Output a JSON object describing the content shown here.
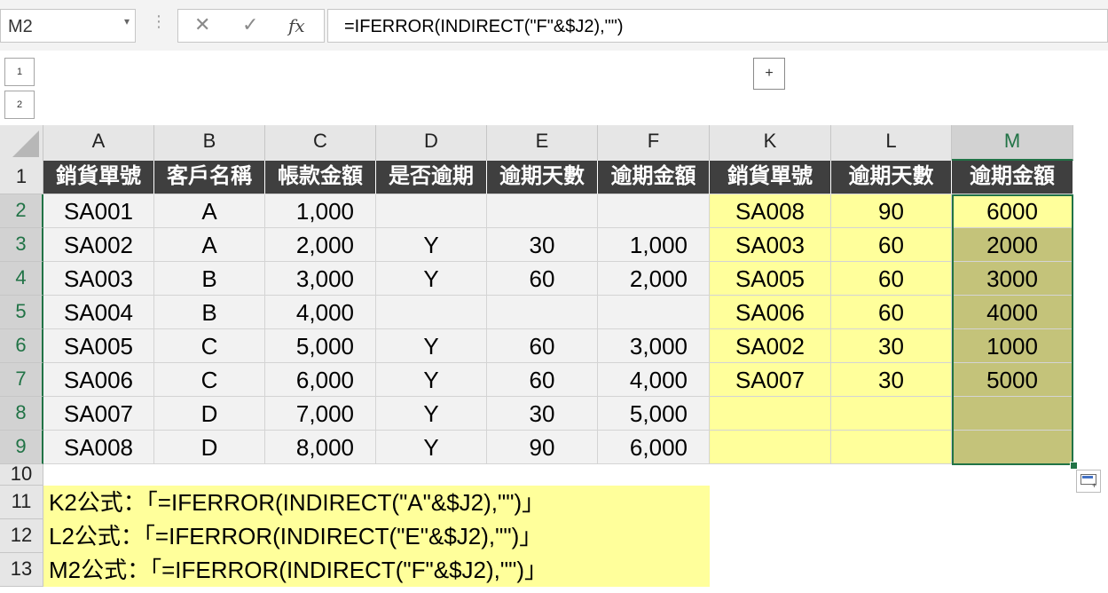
{
  "name_box": "M2",
  "formula_bar": {
    "cancel_glyph": "✕",
    "enter_glyph": "✓",
    "fx_label": "fx",
    "formula": "=IFERROR(INDIRECT(\"F\"&$J2),\"\")"
  },
  "outline": {
    "level_buttons": [
      "1",
      "2"
    ],
    "expand_button": "+"
  },
  "columns": [
    "A",
    "B",
    "C",
    "D",
    "E",
    "F",
    "K",
    "L",
    "M"
  ],
  "selected_column": "M",
  "rows": [
    "1",
    "2",
    "3",
    "4",
    "5",
    "6",
    "7",
    "8",
    "9",
    "10",
    "11",
    "12",
    "13"
  ],
  "selected_rows": [
    "2",
    "3",
    "4",
    "5",
    "6",
    "7",
    "8",
    "9"
  ],
  "table_left": {
    "headers": [
      "銷貨單號",
      "客戶名稱",
      "帳款金額",
      "是否逾期",
      "逾期天數",
      "逾期金額"
    ],
    "rows": [
      [
        "SA001",
        "A",
        "1,000",
        "",
        "",
        ""
      ],
      [
        "SA002",
        "A",
        "2,000",
        "Y",
        "30",
        "1,000"
      ],
      [
        "SA003",
        "B",
        "3,000",
        "Y",
        "60",
        "2,000"
      ],
      [
        "SA004",
        "B",
        "4,000",
        "",
        "",
        ""
      ],
      [
        "SA005",
        "C",
        "5,000",
        "Y",
        "60",
        "3,000"
      ],
      [
        "SA006",
        "C",
        "6,000",
        "Y",
        "60",
        "4,000"
      ],
      [
        "SA007",
        "D",
        "7,000",
        "Y",
        "30",
        "5,000"
      ],
      [
        "SA008",
        "D",
        "8,000",
        "Y",
        "90",
        "6,000"
      ]
    ]
  },
  "table_right": {
    "headers": [
      "銷貨單號",
      "逾期天數",
      "逾期金額"
    ],
    "rows": [
      [
        "SA008",
        "90",
        "6000"
      ],
      [
        "SA003",
        "60",
        "2000"
      ],
      [
        "SA005",
        "60",
        "3000"
      ],
      [
        "SA006",
        "60",
        "4000"
      ],
      [
        "SA002",
        "30",
        "1000"
      ],
      [
        "SA007",
        "30",
        "5000"
      ],
      [
        "",
        "",
        ""
      ],
      [
        "",
        "",
        ""
      ]
    ]
  },
  "notes": [
    "K2公式：「=IFERROR(INDIRECT(\"A\"&$J2),\"\")」",
    "L2公式：「=IFERROR(INDIRECT(\"E\"&$J2),\"\")」",
    "M2公式：「=IFERROR(INDIRECT(\"F\"&$J2),\"\")」"
  ],
  "colors": {
    "selection": "#217346",
    "highlight_yellow": "#ffff9b",
    "selected_fill": "#c4c37a",
    "header_dark": "#3f3f3f"
  },
  "icons": [
    "name-box-dropdown-icon",
    "cancel-icon",
    "enter-icon",
    "insert-function-icon",
    "quick-analysis-icon"
  ]
}
